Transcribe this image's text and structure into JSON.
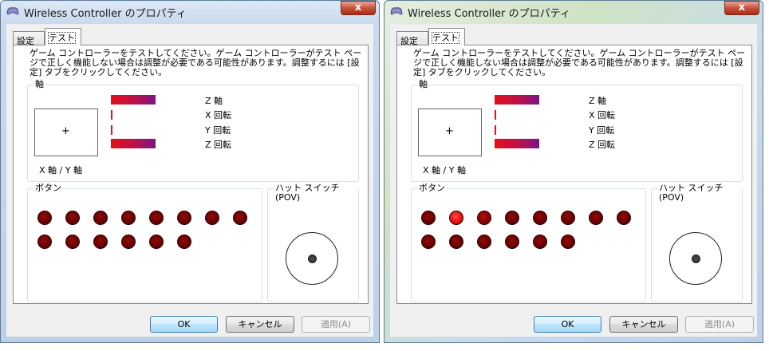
{
  "dialogs": [
    {
      "title": "Wireless Controller のプロパティ",
      "close_label": "x",
      "tabs": [
        "設定",
        "テスト"
      ],
      "description": "ゲーム コントローラーをテストしてください。ゲーム コントローラーがテスト ページで正しく機能しない場合は調整が必要である可能性があります。調整するには [設定] タブをクリックしてください。",
      "axis_group_label": "軸",
      "xy_label": "X 軸 / Y 軸",
      "xy_cursor": "+",
      "axes": [
        {
          "label": "Z 軸",
          "level": 1.0
        },
        {
          "label": "X 回転",
          "level": 0.0
        },
        {
          "label": "Y 回転",
          "level": 0.0
        },
        {
          "label": "Z 回転",
          "level": 1.0
        }
      ],
      "buttons_group_label": "ボタン",
      "buttons_pressed": [
        false,
        false,
        false,
        false,
        false,
        false,
        false,
        false,
        false,
        false,
        false,
        false,
        false,
        false
      ],
      "pov_group_label": "ハット スイッチ (POV)",
      "footer": {
        "ok": "OK",
        "cancel": "キャンセル",
        "apply": "適用(A)"
      }
    },
    {
      "title": "Wireless Controller のプロパティ",
      "close_label": "x",
      "tabs": [
        "設定",
        "テスト"
      ],
      "description": "ゲーム コントローラーをテストしてください。ゲーム コントローラーがテスト ページで正しく機能しない場合は調整が必要である可能性があります。調整するには [設定] タブをクリックしてください。",
      "axis_group_label": "軸",
      "xy_label": "X 軸 / Y 軸",
      "xy_cursor": "+",
      "axes": [
        {
          "label": "Z 軸",
          "level": 1.0
        },
        {
          "label": "X 回転",
          "level": 0.0
        },
        {
          "label": "Y 回転",
          "level": 0.0
        },
        {
          "label": "Z 回転",
          "level": 1.0
        }
      ],
      "buttons_group_label": "ボタン",
      "buttons_pressed": [
        false,
        true,
        true,
        false,
        false,
        false,
        false,
        false,
        false,
        false,
        false,
        false,
        false,
        false
      ],
      "pov_group_label": "ハット スイッチ (POV)",
      "footer": {
        "ok": "OK",
        "cancel": "キャンセル",
        "apply": "適用(A)"
      }
    }
  ],
  "colors": {
    "button_off": "#6c0202",
    "button_on": "#e81010",
    "bar_start": "#e2111b",
    "bar_end": "#7a1585"
  }
}
